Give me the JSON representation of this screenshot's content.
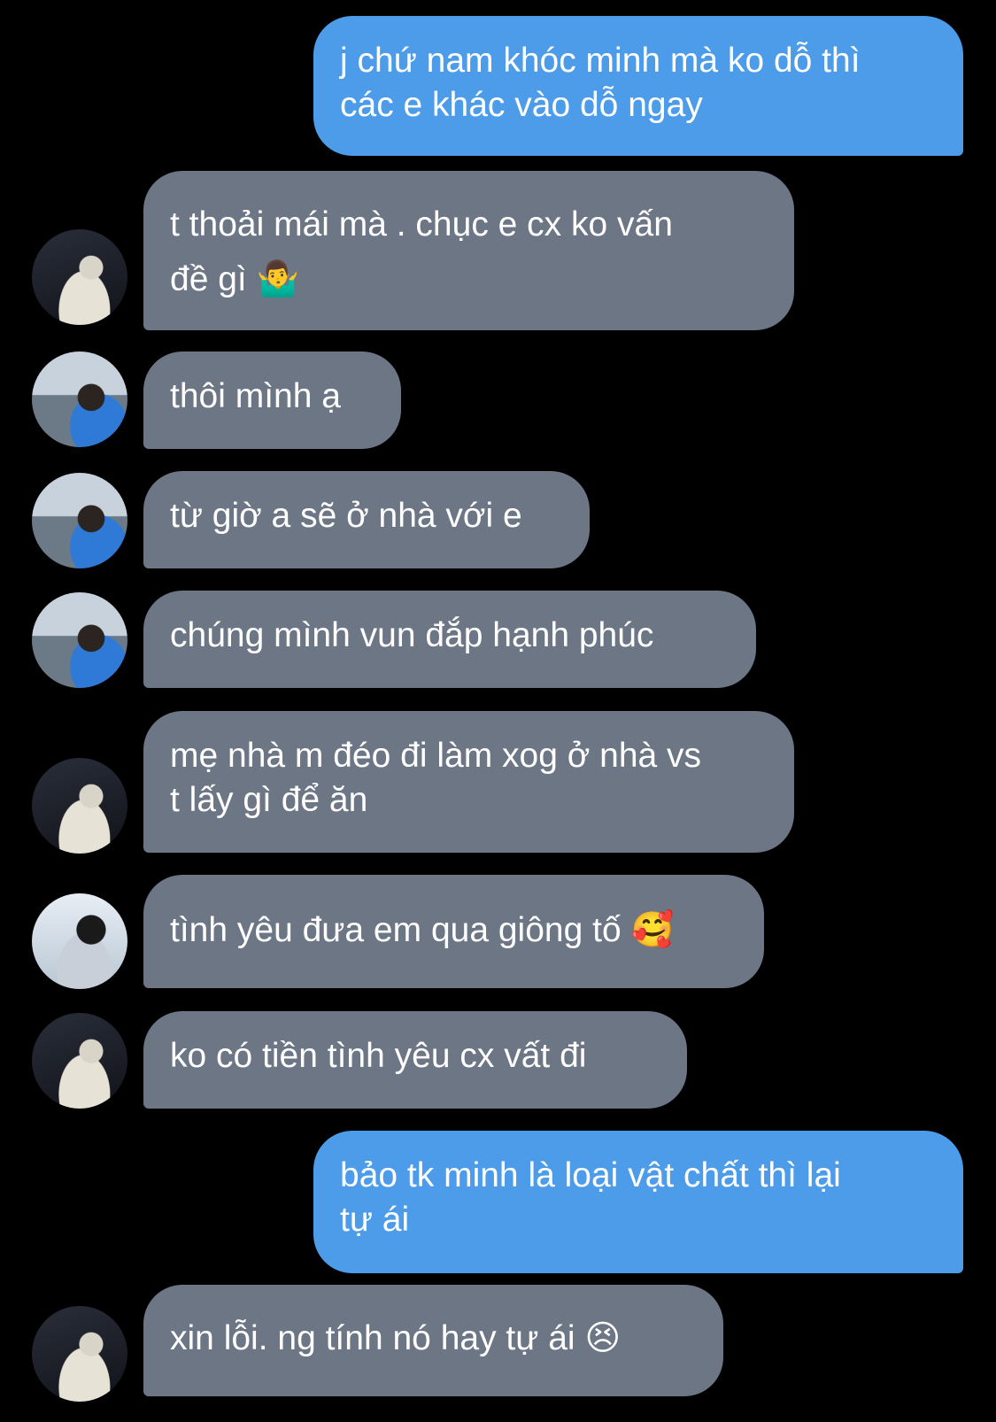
{
  "messages": [
    {
      "side": "sent",
      "text": "j chứ nam khóc minh mà ko dỗ thì\ncác e khác vào dỗ ngay"
    },
    {
      "side": "recv",
      "text": "t thoải mái mà . chục e cx ko vấn\nđề gì 🤷‍♂️",
      "avatar": "avatar-a"
    },
    {
      "side": "recv",
      "text": "thôi mình ạ",
      "avatar": "avatar-b"
    },
    {
      "side": "recv",
      "text": "từ giờ a sẽ ở nhà với e",
      "avatar": "avatar-b"
    },
    {
      "side": "recv",
      "text": "chúng mình vun đắp hạnh phúc",
      "avatar": "avatar-b"
    },
    {
      "side": "recv",
      "text": "mẹ nhà m đéo đi làm xog ở nhà vs\nt lấy gì để ăn",
      "avatar": "avatar-a"
    },
    {
      "side": "recv",
      "text": "tình yêu đưa em qua giông tố 🥰",
      "avatar": "avatar-c"
    },
    {
      "side": "recv",
      "text": "ko có tiền tình yêu cx vất đi",
      "avatar": "avatar-a"
    },
    {
      "side": "sent",
      "text": "bảo tk minh là loại vật chất thì lại\ntự ái"
    },
    {
      "side": "recv",
      "text": "xin lỗi. ng tính nó hay tự ái 😣",
      "avatar": "avatar-a"
    }
  ],
  "colors": {
    "background": "#000000",
    "sent_bubble": "#4d9ce9",
    "received_bubble": "#6c7685",
    "text": "#ffffff"
  }
}
